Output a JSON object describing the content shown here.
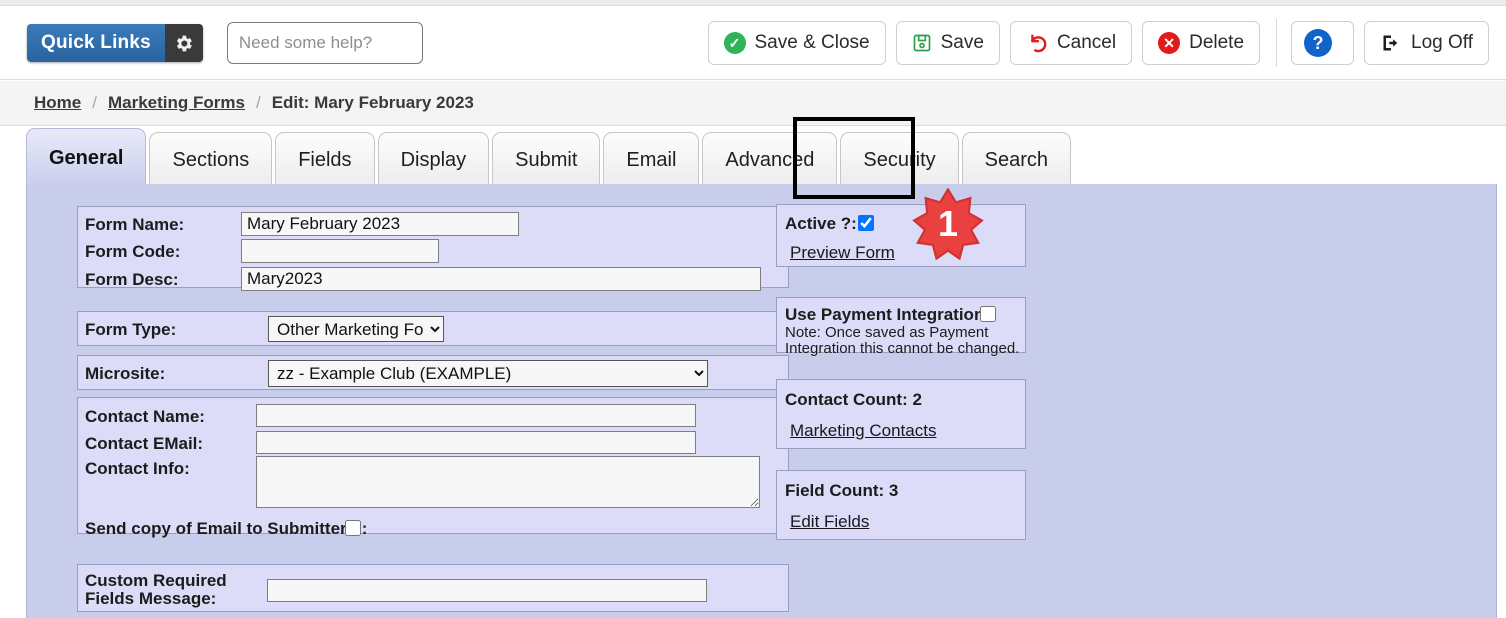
{
  "header": {
    "quick_links_label": "Quick Links",
    "gear_icon": "gear-icon",
    "help_placeholder": "Need some help?",
    "buttons": [
      {
        "label": "Save & Close",
        "icon": "check-circle-icon"
      },
      {
        "label": "Save",
        "icon": "floppy-disk-icon"
      },
      {
        "label": "Cancel",
        "icon": "undo-arrow-icon"
      },
      {
        "label": "Delete",
        "icon": "x-circle-icon"
      },
      {
        "label": "",
        "icon": "help-question-icon"
      },
      {
        "label": "Log Off",
        "icon": "logout-icon"
      }
    ]
  },
  "breadcrumb": {
    "home": "Home",
    "section": "Marketing Forms",
    "current": "Edit: Mary February 2023",
    "separator": "/"
  },
  "tabs": [
    {
      "label": "General",
      "active": true
    },
    {
      "label": "Sections",
      "active": false
    },
    {
      "label": "Fields",
      "active": false
    },
    {
      "label": "Display",
      "active": false
    },
    {
      "label": "Submit",
      "active": false
    },
    {
      "label": "Email",
      "active": false
    },
    {
      "label": "Advanced",
      "active": false
    },
    {
      "label": "Security",
      "active": false,
      "highlighted": true
    },
    {
      "label": "Search",
      "active": false
    }
  ],
  "annotation": {
    "badge_number": "1",
    "badge_color": "#e8413f"
  },
  "form": {
    "name_label": "Form Name:",
    "name_value": "Mary February 2023",
    "code_label": "Form Code:",
    "code_value": "",
    "desc_label": "Form Desc:",
    "desc_value": "Mary2023",
    "type_label": "Form Type:",
    "type_value": "Other Marketing Form",
    "type_options": [
      "Other Marketing Form"
    ],
    "microsite_label": "Microsite:",
    "microsite_value": "zz - Example Club (EXAMPLE)",
    "microsite_options": [
      "zz - Example Club (EXAMPLE)"
    ],
    "contact_name_label": "Contact Name:",
    "contact_name_value": "",
    "contact_email_label": "Contact EMail:",
    "contact_email_value": "",
    "contact_info_label": "Contact Info:",
    "contact_info_value": "",
    "send_copy_label": "Send copy of Email to Submitter ?:",
    "send_copy_checked": false,
    "custom_required_label": "Custom Required Fields Message:",
    "custom_required_value": ""
  },
  "side": {
    "active_label": "Active ?:",
    "active_checked": true,
    "preview_link": "Preview Form",
    "payment_label": "Use Payment Integration:",
    "payment_checked": false,
    "payment_note": "Note: Once saved as Payment Integration this cannot be changed.",
    "contact_count_label": "Contact Count: 2",
    "marketing_contacts_link": "Marketing Contacts",
    "field_count_label": "Field Count: 3",
    "edit_fields_link": "Edit Fields"
  },
  "colors": {
    "content_bg": "#c8cdec",
    "panel_bg": "#dcdcf8",
    "accent_blue": "#2a639f",
    "badge_red": "#e8413f"
  }
}
